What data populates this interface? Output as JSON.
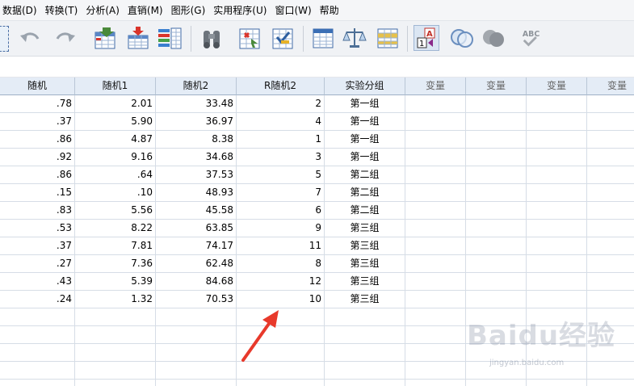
{
  "menu": [
    "数据(D)",
    "转换(T)",
    "分析(A)",
    "直销(M)",
    "图形(G)",
    "实用程序(U)",
    "窗口(W)",
    "帮助"
  ],
  "toolbar": {
    "icons": [
      "undo-icon",
      "redo-icon",
      "goto-case-icon",
      "goto-variable-icon",
      "variables-icon",
      "find-icon",
      "insert-cases-icon",
      "insert-variable-icon",
      "split-file-icon",
      "weight-cases-icon",
      "select-cases-icon",
      "value-labels-icon",
      "use-variable-sets-icon",
      "show-all-variables-icon",
      "spell-check-icon"
    ]
  },
  "columns": [
    "随机",
    "随机1",
    "随机2",
    "R随机2",
    "实验分组",
    "变量",
    "变量",
    "变量",
    "变量"
  ],
  "rows": [
    [
      ".78",
      "2.01",
      "33.48",
      "2",
      "第一组"
    ],
    [
      ".37",
      "5.90",
      "36.97",
      "4",
      "第一组"
    ],
    [
      ".86",
      "4.87",
      "8.38",
      "1",
      "第一组"
    ],
    [
      ".92",
      "9.16",
      "34.68",
      "3",
      "第一组"
    ],
    [
      ".86",
      ".64",
      "37.53",
      "5",
      "第二组"
    ],
    [
      ".15",
      ".10",
      "48.93",
      "7",
      "第二组"
    ],
    [
      ".83",
      "5.56",
      "45.58",
      "6",
      "第二组"
    ],
    [
      ".53",
      "8.22",
      "63.85",
      "9",
      "第三组"
    ],
    [
      ".37",
      "7.81",
      "74.17",
      "11",
      "第三组"
    ],
    [
      ".27",
      "7.36",
      "62.48",
      "8",
      "第三组"
    ],
    [
      ".43",
      "5.39",
      "84.68",
      "12",
      "第三组"
    ],
    [
      ".24",
      "1.32",
      "70.53",
      "10",
      "第三组"
    ]
  ],
  "watermark": {
    "logo": "Baidu经验",
    "url": "jingyan.baidu.com"
  },
  "colors": {
    "arrow": "#e8392b",
    "header_bg": "#e4ecf6"
  }
}
